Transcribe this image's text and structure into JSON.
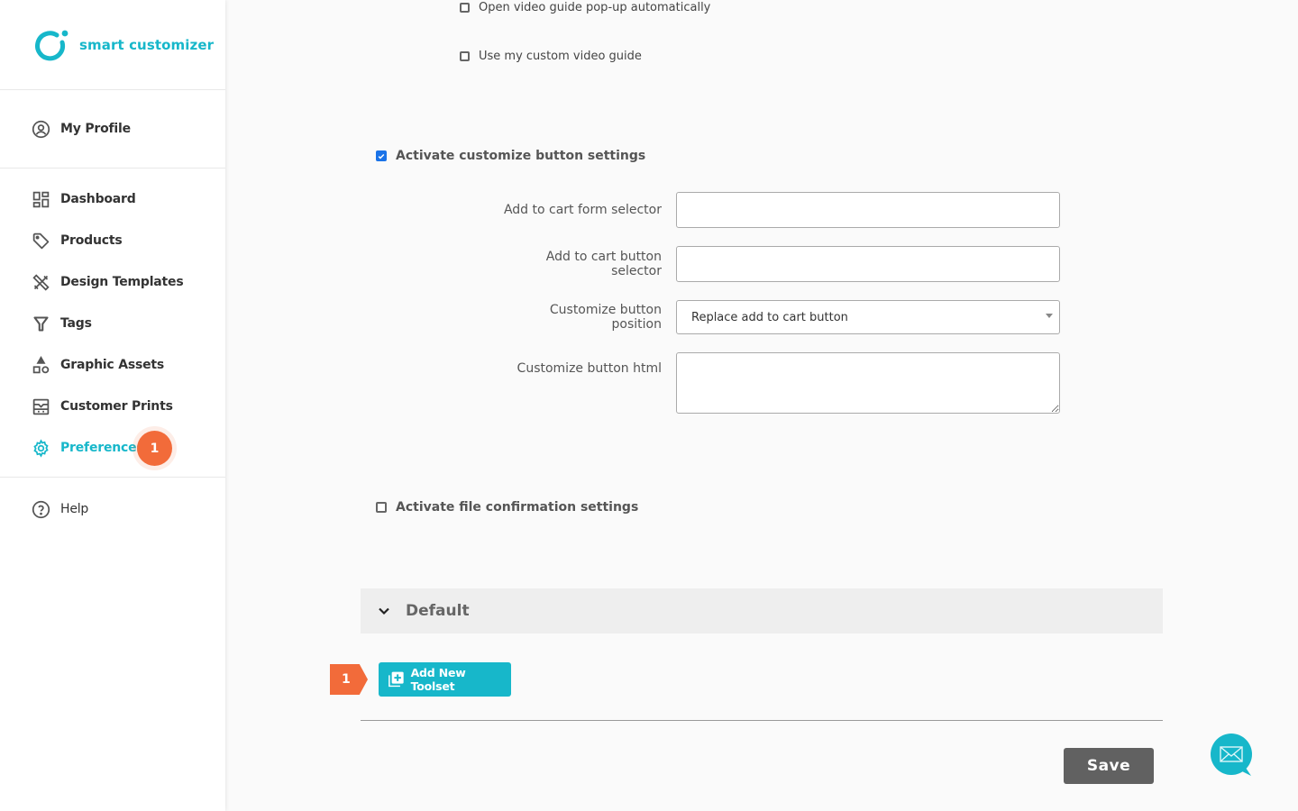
{
  "app": {
    "name": "smart customizer",
    "brand_color": "#17b7ca",
    "accent_orange": "#f26b3a"
  },
  "sidebar": {
    "profile": {
      "label": "My Profile",
      "icon": "user-circle-icon"
    },
    "items": [
      {
        "label": "Dashboard",
        "icon": "dashboard-icon",
        "active": false
      },
      {
        "label": "Products",
        "icon": "tag-icon",
        "active": false
      },
      {
        "label": "Design Templates",
        "icon": "design-tools-icon",
        "active": false
      },
      {
        "label": "Tags",
        "icon": "filter-icon",
        "active": false
      },
      {
        "label": "Graphic Assets",
        "icon": "shapes-icon",
        "active": false
      },
      {
        "label": "Customer Prints",
        "icon": "prints-icon",
        "active": false
      },
      {
        "label": "Preferences",
        "icon": "gear-icon",
        "active": true,
        "badge": "1"
      }
    ],
    "help": {
      "label": "Help",
      "icon": "help-circle-icon"
    }
  },
  "main": {
    "video_guide": {
      "open_popup_label": "Open video guide pop-up automatically",
      "open_popup_checked": false,
      "custom_guide_label": "Use my custom video guide",
      "custom_guide_checked": false
    },
    "customize_button": {
      "activate_label": "Activate customize button settings",
      "activate_checked": true,
      "fields": {
        "form_selector": {
          "label": "Add to cart form selector",
          "value": ""
        },
        "button_selector": {
          "label": "Add to cart button selector",
          "value": ""
        },
        "position": {
          "label": "Customize button position",
          "value": "Replace add to cart button"
        },
        "html": {
          "label": "Customize button html",
          "value": ""
        }
      }
    },
    "file_confirmation": {
      "activate_label": "Activate file confirmation settings",
      "activate_checked": false
    },
    "toolset_section": {
      "title": "Default",
      "step_badge": "1",
      "add_button_label": "Add New Toolset"
    },
    "save_label": "Save"
  }
}
